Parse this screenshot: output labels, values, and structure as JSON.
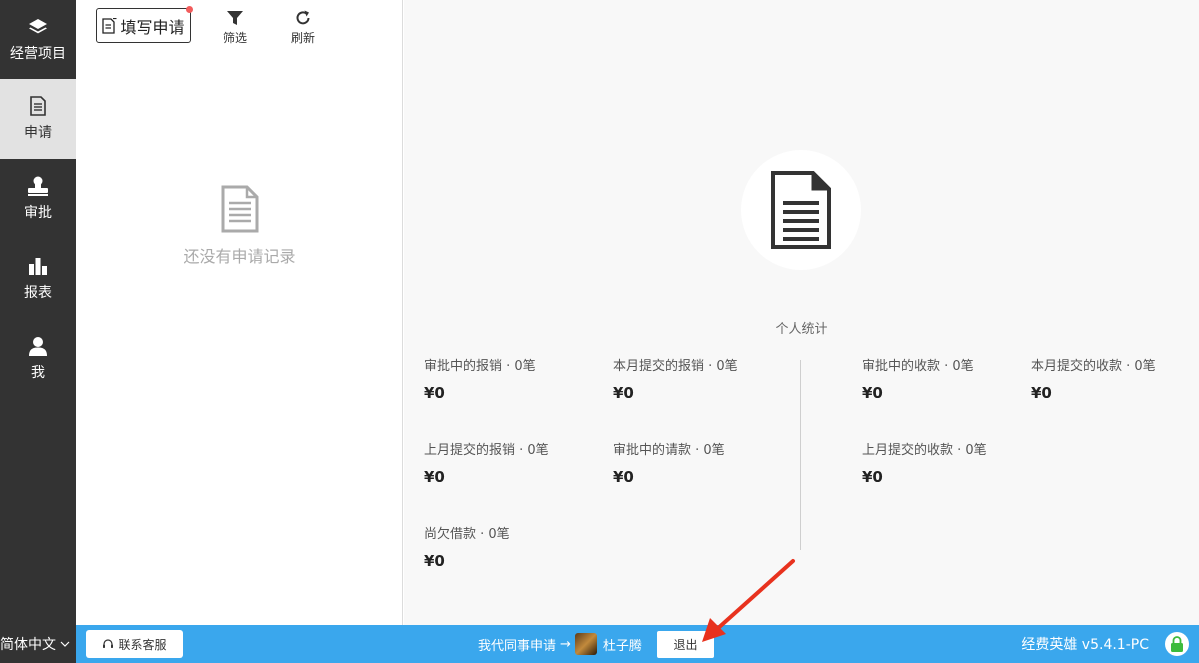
{
  "sidebar": {
    "items": [
      {
        "label": "经营项目",
        "icon": "layers-icon"
      },
      {
        "label": "申请",
        "icon": "document-icon",
        "active": true
      },
      {
        "label": "审批",
        "icon": "stamp-icon"
      },
      {
        "label": "报表",
        "icon": "bar-chart-icon"
      },
      {
        "label": "我",
        "icon": "user-icon"
      }
    ]
  },
  "toolbar": {
    "apply_label": "填写申请",
    "filter_label": "筛选",
    "refresh_label": "刷新"
  },
  "list": {
    "empty_text": "还没有申请记录"
  },
  "stats": {
    "title": "个人统计",
    "items": [
      {
        "label": "审批中的报销 · 0笔",
        "amount": "¥0"
      },
      {
        "label": "本月提交的报销 · 0笔",
        "amount": "¥0"
      },
      {
        "label": "上月提交的报销 · 0笔",
        "amount": "¥0"
      },
      {
        "label": "审批中的请款 · 0笔",
        "amount": "¥0"
      },
      {
        "label": "尚欠借款 · 0笔",
        "amount": "¥0"
      },
      {
        "label": "审批中的收款 · 0笔",
        "amount": "¥0"
      },
      {
        "label": "本月提交的收款 · 0笔",
        "amount": "¥0"
      },
      {
        "label": "上月提交的收款 · 0笔",
        "amount": "¥0"
      }
    ]
  },
  "bottombar": {
    "language": "简体中文",
    "customer_service": "联系客服",
    "proxy_label": "我代同事申请",
    "proxy_arrow": "→",
    "user_name": "杜子腾",
    "logout_label": "退出",
    "version": "经费英雄 v5.4.1-PC"
  },
  "colors": {
    "sidebar_bg": "#333333",
    "bottombar_bg": "#3aa7ed",
    "notify_dot": "#f25c5c",
    "lock_green": "#3dbb3d",
    "annotation_arrow": "#e8321e"
  }
}
